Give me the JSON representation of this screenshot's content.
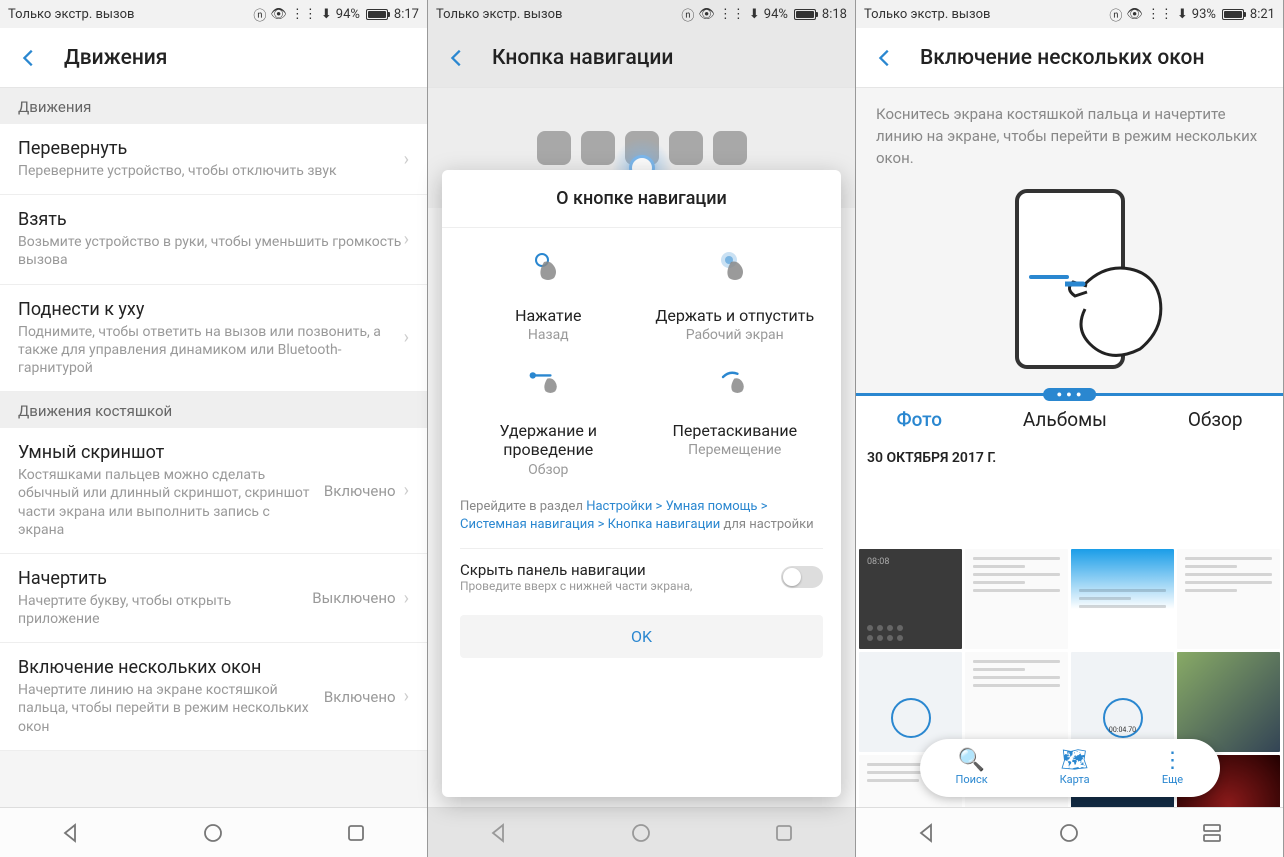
{
  "screen1": {
    "status": {
      "carrier": "Только экстр. вызов",
      "battery_pct": "94%",
      "time": "8:17"
    },
    "title": "Движения",
    "section1_header": "Движения",
    "items1": [
      {
        "title": "Перевернуть",
        "sub": "Переверните устройство, чтобы отключить звук"
      },
      {
        "title": "Взять",
        "sub": "Возьмите устройство в руки, чтобы уменьшить громкость вызова"
      },
      {
        "title": "Поднести к уху",
        "sub": "Поднимите, чтобы ответить на вызов или позвонить, а также для управления динамиком или Bluetooth-гарнитурой"
      }
    ],
    "section2_header": "Движения костяшкой",
    "items2": [
      {
        "title": "Умный скриншот",
        "sub": "Костяшками пальцев можно сделать обычный или длинный скриншот, скриншот части экрана или выполнить запись с экрана",
        "value": "Включено"
      },
      {
        "title": "Начертить",
        "sub": "Начертите букву, чтобы открыть приложение",
        "value": "Выключено"
      },
      {
        "title": "Включение нескольких окон",
        "sub": "Начертите линию на экране костяшкой пальца, чтобы перейти в режим нескольких окон",
        "value": "Включено"
      }
    ]
  },
  "screen2": {
    "status": {
      "carrier": "Только экстр. вызов",
      "battery_pct": "94%",
      "time": "8:18"
    },
    "title": "Кнопка навигации",
    "modal_title": "О кнопке навигации",
    "gestures": [
      {
        "title": "Нажатие",
        "sub": "Назад"
      },
      {
        "title": "Держать и отпустить",
        "sub": "Рабочий экран"
      },
      {
        "title": "Удержание и проведение",
        "sub": "Обзор"
      },
      {
        "title": "Перетаскивание",
        "sub": "Перемещение"
      }
    ],
    "note_prefix": "Перейдите в раздел ",
    "note_link": "Настройки > Умная помощь > Системная навигация > Кнопка навигации",
    "note_suffix": " для настройки",
    "hide_title": "Скрыть панель навигации",
    "hide_sub": "Проведите вверх с нижней части экрана,",
    "ok": "OK"
  },
  "screen3": {
    "status": {
      "carrier": "Только экстр. вызов",
      "battery_pct": "93%",
      "time": "8:21"
    },
    "title": "Включение нескольких окон",
    "desc": "Коснитесь экрана костяшкой пальца и начертите линию на экране, чтобы перейти в режим нескольких окон.",
    "tabs": {
      "photo": "Фото",
      "albums": "Альбомы",
      "review": "Обзор"
    },
    "date": "30 ОКТЯБРЯ 2017 Г.",
    "toolbar": {
      "search": "Поиск",
      "map": "Карта",
      "more": "Еще"
    }
  }
}
